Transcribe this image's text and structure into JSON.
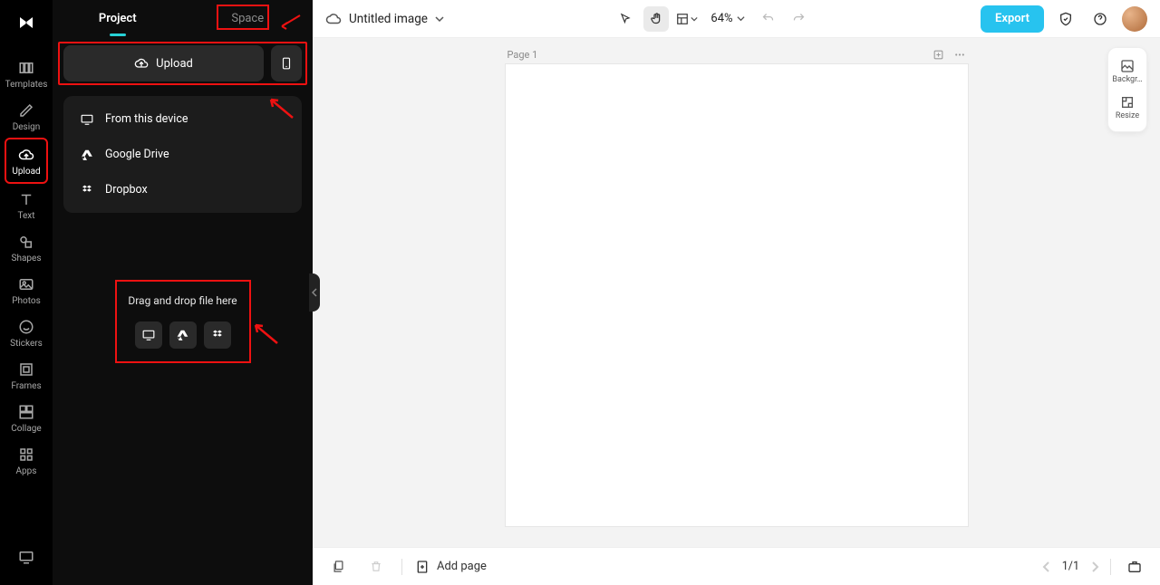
{
  "rail": {
    "items": [
      {
        "label": "Templates"
      },
      {
        "label": "Design"
      },
      {
        "label": "Upload"
      },
      {
        "label": "Text"
      },
      {
        "label": "Shapes"
      },
      {
        "label": "Photos"
      },
      {
        "label": "Stickers"
      },
      {
        "label": "Frames"
      },
      {
        "label": "Collage"
      },
      {
        "label": "Apps"
      }
    ]
  },
  "panel": {
    "tabs": {
      "project": "Project",
      "space": "Space"
    },
    "upload_label": "Upload",
    "dropdown": {
      "device": "From this device",
      "gdrive": "Google Drive",
      "dropbox": "Dropbox"
    },
    "drop_text": "Drag and drop file here"
  },
  "topbar": {
    "title": "Untitled image",
    "zoom": "64%",
    "export": "Export"
  },
  "float": {
    "bg": "Backgr…",
    "resize": "Resize"
  },
  "canvas": {
    "page_label": "Page 1"
  },
  "bottombar": {
    "add_page": "Add page",
    "pager": "1/1"
  }
}
